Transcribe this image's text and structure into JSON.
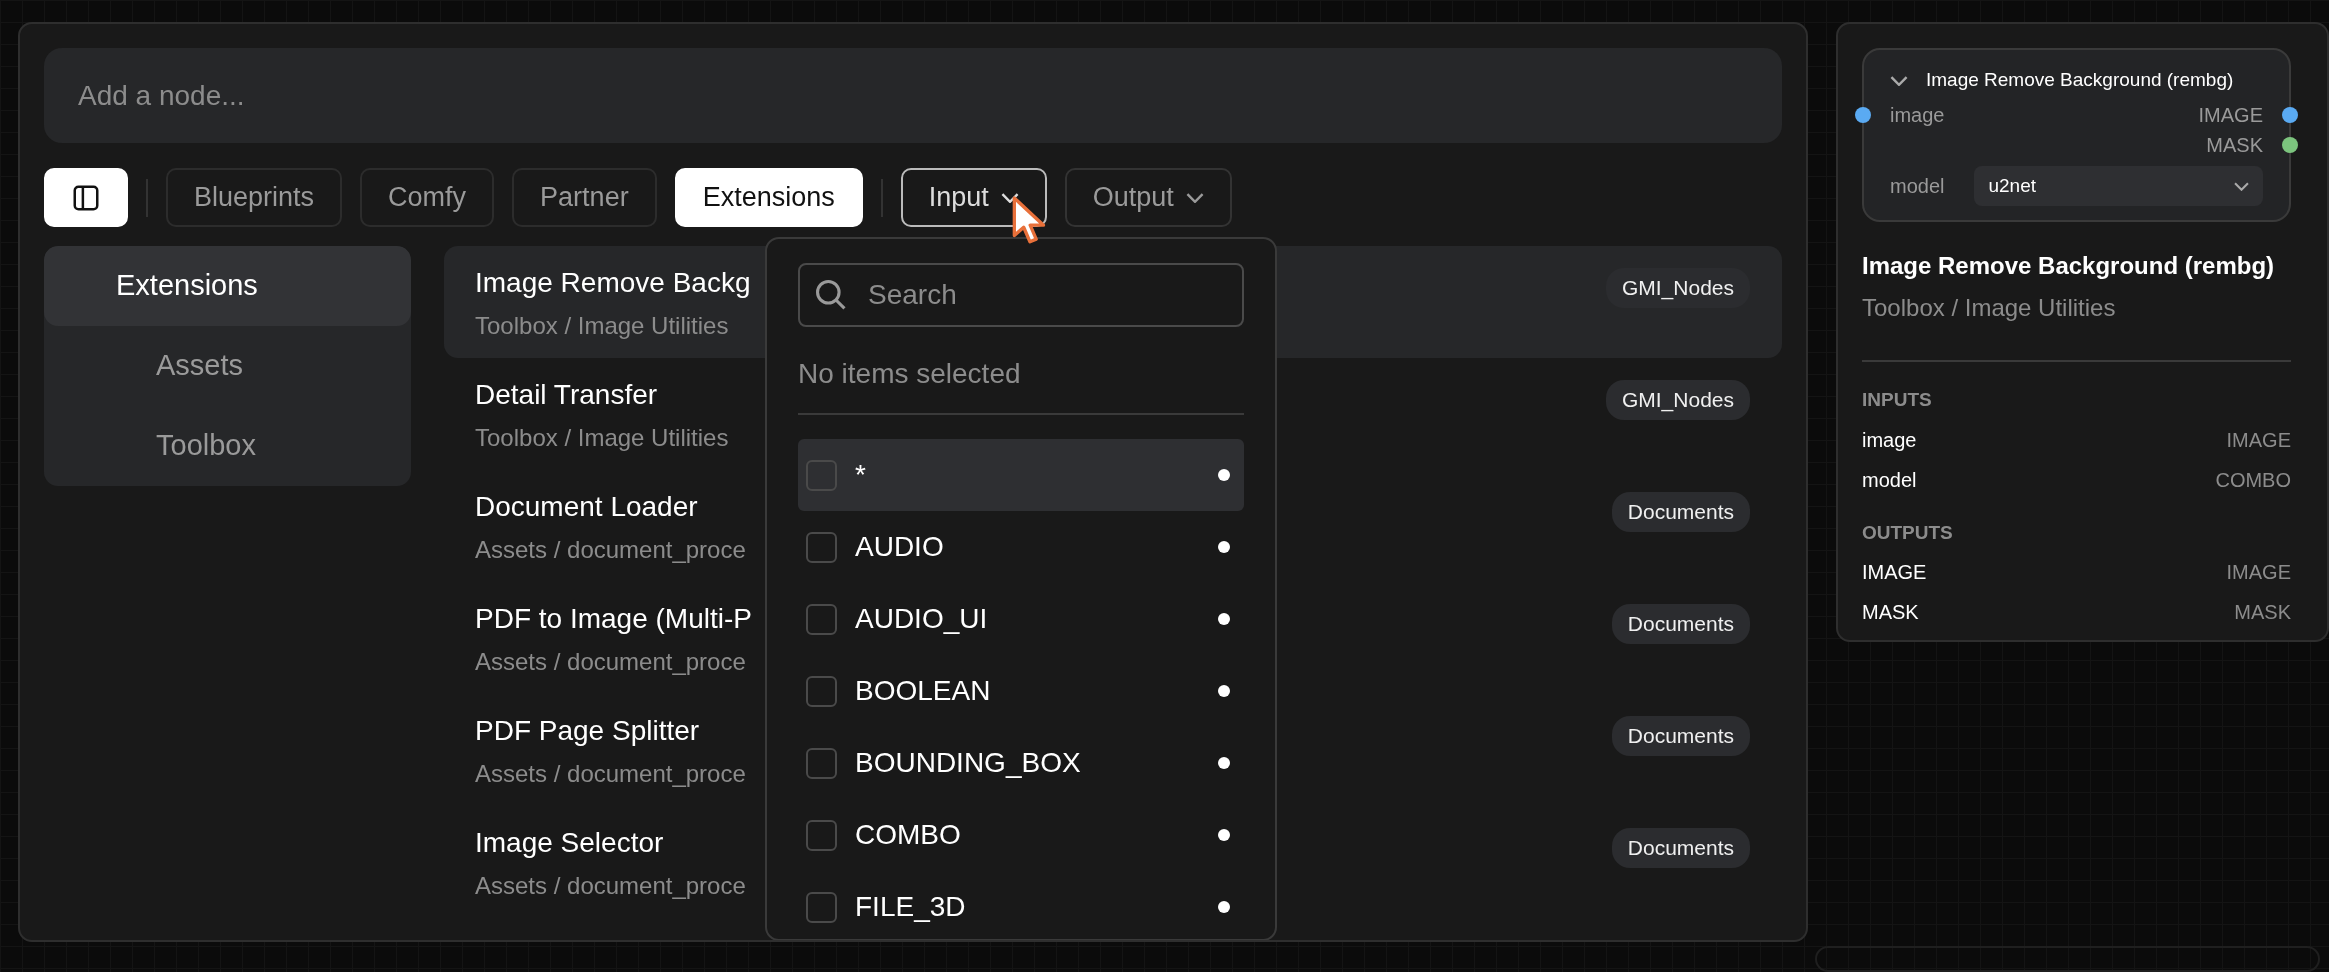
{
  "search": {
    "placeholder": "Add a node..."
  },
  "sidebar_toggle": {
    "selected": true
  },
  "tabs": [
    {
      "label": "Blueprints",
      "selected": false
    },
    {
      "label": "Comfy",
      "selected": false
    },
    {
      "label": "Partner",
      "selected": false
    },
    {
      "label": "Extensions",
      "selected": true
    }
  ],
  "filters": [
    {
      "label": "Input",
      "expanded": true
    },
    {
      "label": "Output",
      "expanded": false
    }
  ],
  "categories": [
    {
      "label": "Extensions",
      "selected": true,
      "children": [
        {
          "label": "Assets",
          "selected": false
        },
        {
          "label": "Toolbox",
          "selected": false
        }
      ]
    }
  ],
  "results": [
    {
      "title": "Image Remove Backg",
      "path": "Toolbox / Image Utilities",
      "badge": "GMI_Nodes",
      "selected": true
    },
    {
      "title": "Detail Transfer",
      "path": "Toolbox / Image Utilities",
      "badge": "GMI_Nodes",
      "selected": false
    },
    {
      "title": "Document Loader",
      "path": "Assets / document_proce",
      "badge": "Documents",
      "selected": false
    },
    {
      "title": "PDF to Image (Multi-P",
      "path": "Assets / document_proce",
      "badge": "Documents",
      "selected": false
    },
    {
      "title": "PDF Page Splitter",
      "path": "Assets / document_proce",
      "badge": "Documents",
      "selected": false
    },
    {
      "title": "Image Selector",
      "path": "Assets / document_proce",
      "badge": "Documents",
      "selected": false
    }
  ],
  "input_dropdown": {
    "search_placeholder": "Search",
    "status": "No items selected",
    "options": [
      {
        "label": "*",
        "checked": false,
        "highlighted": true
      },
      {
        "label": "AUDIO",
        "checked": false,
        "highlighted": false
      },
      {
        "label": "AUDIO_UI",
        "checked": false,
        "highlighted": false
      },
      {
        "label": "BOOLEAN",
        "checked": false,
        "highlighted": false
      },
      {
        "label": "BOUNDING_BOX",
        "checked": false,
        "highlighted": false
      },
      {
        "label": "COMBO",
        "checked": false,
        "highlighted": false
      },
      {
        "label": "FILE_3D",
        "checked": false,
        "highlighted": false
      }
    ]
  },
  "preview": {
    "node": {
      "title": "Image Remove Background (rembg)",
      "expanded": true,
      "inputs": [
        {
          "name": "image",
          "color": "#5aaaf2"
        }
      ],
      "outputs": [
        {
          "name": "IMAGE",
          "color": "#5aaaf2"
        },
        {
          "name": "MASK",
          "color": "#7cc47e"
        }
      ],
      "widgets": [
        {
          "label": "model",
          "value": "u2net"
        }
      ]
    },
    "title": "Image Remove Background (rembg)",
    "path": "Toolbox / Image Utilities",
    "inputs_heading": "INPUTS",
    "inputs": [
      {
        "name": "image",
        "type": "IMAGE"
      },
      {
        "name": "model",
        "type": "COMBO"
      }
    ],
    "outputs_heading": "OUTPUTS",
    "outputs": [
      {
        "name": "IMAGE",
        "type": "IMAGE"
      },
      {
        "name": "MASK",
        "type": "MASK"
      }
    ]
  }
}
